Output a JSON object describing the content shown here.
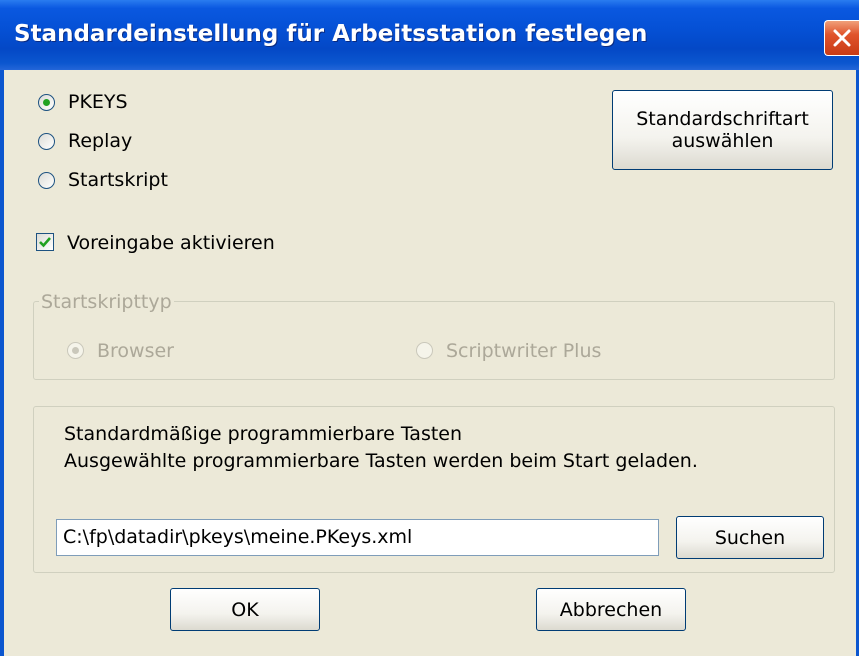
{
  "window": {
    "title": "Standardeinstellung für Arbeitsstation festlegen",
    "close_icon": "close-icon",
    "colors": {
      "titlebar": "#0551d6",
      "close": "#e0542c",
      "dialog_bg": "#ece9d8",
      "disabled_text": "#aca899"
    }
  },
  "startup_mode": {
    "options": [
      {
        "label": "PKEYS",
        "selected": true
      },
      {
        "label": "Replay",
        "selected": false
      },
      {
        "label": "Startskript",
        "selected": false
      }
    ]
  },
  "font_button": {
    "line1": "Standardschriftart",
    "line2": "auswählen"
  },
  "preset": {
    "label": "Voreingabe aktivieren",
    "checked": true
  },
  "script_type": {
    "legend": "Startskripttyp",
    "enabled": false,
    "options": [
      {
        "label": "Browser",
        "selected": true
      },
      {
        "label": "Scriptwriter Plus",
        "selected": false
      }
    ]
  },
  "keys": {
    "line1": "Standardmäßige programmierbare Tasten",
    "line2": "Ausgewählte programmierbare Tasten werden beim Start geladen.",
    "path_value": "C:\\fp\\datadir\\pkeys\\meine.PKeys.xml",
    "search_label": "Suchen"
  },
  "footer": {
    "ok_label": "OK",
    "cancel_label": "Abbrechen"
  }
}
